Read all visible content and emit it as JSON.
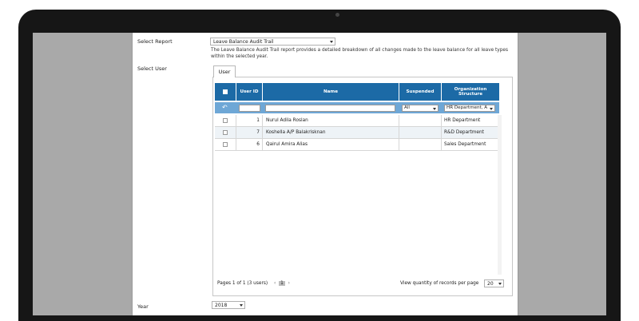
{
  "report": {
    "label": "Select Report",
    "selected": "Leave Balance Audit Trail",
    "description": "The Leave Balance Audit Trail report provides a detailed breakdown of all changes made to the leave balance for all leave types within the selected year."
  },
  "user_section": {
    "label": "Select User",
    "tab": "User"
  },
  "grid": {
    "headers": [
      "User ID",
      "Name",
      "Suspended",
      "Organization Structure"
    ],
    "filters": {
      "suspended": "All",
      "org": "HR Department, A"
    },
    "rows": [
      {
        "id": "1",
        "name": "Nurul Adila Roslan",
        "suspended": "",
        "org": "HR Department"
      },
      {
        "id": "7",
        "name": "Koshella A/P Balakrisknan",
        "suspended": "",
        "org": "R&D Department"
      },
      {
        "id": "6",
        "name": "Qairul Amira Alias",
        "suspended": "",
        "org": "Sales Department"
      }
    ]
  },
  "pagination": {
    "summary": "Pages 1 of 1 (3 users)",
    "current_page": "1",
    "quantity_label": "View quantity of records per page",
    "quantity": "20"
  },
  "year": {
    "label": "Year",
    "selected": "2018"
  }
}
